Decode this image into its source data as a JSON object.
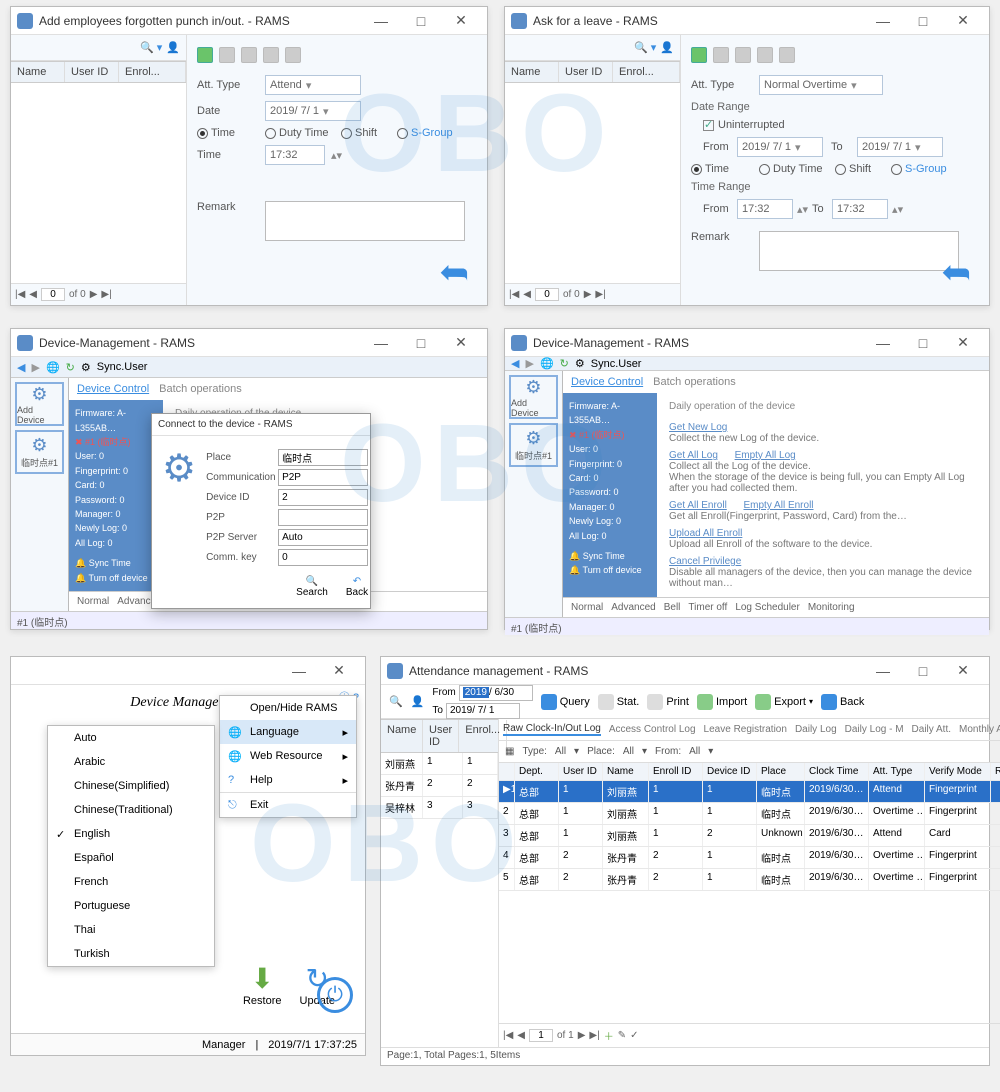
{
  "watermark": "OBO",
  "win_punch": {
    "title": "Add employees forgotten punch in/out. - RAMS",
    "cols": [
      "Name",
      "User ID",
      "Enrol..."
    ],
    "att_type_lbl": "Att. Type",
    "att_type_val": "Attend",
    "date_lbl": "Date",
    "date_val": "2019/ 7/ 1",
    "r_time": "Time",
    "r_duty": "Duty Time",
    "r_shift": "Shift",
    "r_sgroup": "S-Group",
    "time_lbl": "Time",
    "time_val": "17:32",
    "remark_lbl": "Remark",
    "nav_page": "0",
    "nav_total": "of 0"
  },
  "win_leave": {
    "title": "Ask for a leave - RAMS",
    "cols": [
      "Name",
      "User ID",
      "Enrol..."
    ],
    "att_type_lbl": "Att. Type",
    "att_type_val": "Normal Overtime",
    "range_hd": "Date Range",
    "uninterrupted": "Uninterrupted",
    "from_lbl": "From",
    "to_lbl": "To",
    "from_date": "2019/ 7/ 1",
    "to_date": "2019/ 7/ 1",
    "r_time": "Time",
    "r_duty": "Duty Time",
    "r_shift": "Shift",
    "r_sgroup": "S-Group",
    "time_range_hd": "Time Range",
    "t_from": "17:32",
    "t_to": "17:32",
    "remark_lbl": "Remark",
    "nav_page": "0",
    "nav_total": "of 0"
  },
  "dm": {
    "title": "Device-Management - RAMS",
    "syncuser": "Sync.User",
    "side_add": "Add Device",
    "side_dev": "临时点#1",
    "tab_ctrl": "Device Control",
    "tab_batch": "Batch operations",
    "tree": {
      "fw": "Firmware: A-L355AB…",
      "dev": "#1 (临时点)",
      "user": "User: 0",
      "fp": "Fingerprint: 0",
      "card": "Card: 0",
      "pw": "Password: 0",
      "mgr": "Manager: 0",
      "newlog": "Newly Log: 0",
      "alllog": "All Log: 0",
      "sync": "Sync Time",
      "turnoff": "Turn off device"
    },
    "ops": {
      "hd": "Daily operation of the device",
      "getnew": "Get New Log",
      "getnew_d": "Collect the new Log of the device.",
      "getall": "Get All Log",
      "emptyall": "Empty All Log",
      "getall_d1": "Collect all the Log of the device.",
      "getall_d2": "When the storage of the device is being full, you can Empty All Log after you had collected them.",
      "getenroll": "Get All Enroll",
      "emptyenroll": "Empty All Enroll",
      "getenroll_d": "Get all Enroll(Fingerprint, Password, Card) from the…",
      "upload": "Upload All Enroll",
      "upload_d": "Upload all Enroll of the software to the device.",
      "cancel": "Cancel Privilege",
      "cancel_d": "Disable all managers of the device, then you can manage the device without man…"
    },
    "footer_tabs": [
      "Normal",
      "Advanced",
      "Bell",
      "Timer off",
      "Log Scheduler",
      "Monitoring"
    ],
    "status": "#1 (临时点)"
  },
  "connect": {
    "title": "Connect to the device - RAMS",
    "place_l": "Place",
    "place_v": "临时点",
    "comm_l": "Communication",
    "comm_v": "P2P",
    "devid_l": "Device ID",
    "devid_v": "2",
    "p2p_l": "P2P",
    "p2p_v": "",
    "srv_l": "P2P Server",
    "srv_v": "Auto",
    "key_l": "Comm. key",
    "key_v": "0",
    "btn_search": "Search",
    "btn_back": "Back"
  },
  "lang": {
    "heading": "Device Management",
    "menu": [
      "Open/Hide  RAMS",
      "Language",
      "Web Resource",
      "Help",
      "Exit"
    ],
    "langs": [
      "Auto",
      "Arabic",
      "Chinese(Simplified)",
      "Chinese(Traditional)",
      "English",
      "Español",
      "French",
      "Portuguese",
      "Thai",
      "Turkish"
    ],
    "restore": "Restore",
    "update": "Update",
    "status_user": "Manager",
    "status_time": "2019/7/1 17:37:25"
  },
  "att": {
    "title": "Attendance management - RAMS",
    "from_lbl": "From",
    "from_val": "2019/ 6/30",
    "to_lbl": "To",
    "to_val": "2019/ 7/ 1",
    "btn_query": "Query",
    "btn_stat": "Stat.",
    "btn_print": "Print",
    "btn_import": "Import",
    "btn_export": "Export",
    "btn_back": "Back",
    "left_cols": [
      "Name",
      "User ID",
      "Enrol..."
    ],
    "left_rows": [
      {
        "name": "刘丽燕",
        "uid": "1",
        "eid": "1"
      },
      {
        "name": "张丹青",
        "uid": "2",
        "eid": "2"
      },
      {
        "name": "吴梓林",
        "uid": "3",
        "eid": "3"
      }
    ],
    "tabs": [
      "Raw Clock-In/Out Log",
      "Access Control Log",
      "Leave Registration",
      "Daily Log",
      "Daily Log - M",
      "Daily Att.",
      "Monthly Att"
    ],
    "flt_type_l": "Type:",
    "flt_type_v": "All",
    "flt_place_l": "Place:",
    "flt_place_v": "All",
    "flt_from_l": "From:",
    "flt_from_v": "All",
    "grid_cols": [
      "",
      "Dept.",
      "User ID",
      "Name",
      "Enroll ID",
      "Device ID",
      "Place",
      "Clock Time",
      "Att. Type",
      "Verify Mode",
      "Remark"
    ],
    "grid_rows": [
      {
        "n": "1",
        "dept": "总部",
        "uid": "1",
        "name": "刘丽燕",
        "eid": "1",
        "did": "1",
        "place": "临时点",
        "time": "2019/6/30…",
        "type": "Attend",
        "verify": "Fingerprint",
        "rm": ""
      },
      {
        "n": "2",
        "dept": "总部",
        "uid": "1",
        "name": "刘丽燕",
        "eid": "1",
        "did": "1",
        "place": "临时点",
        "time": "2019/6/30…",
        "type": "Overtime …",
        "verify": "Fingerprint",
        "rm": ""
      },
      {
        "n": "3",
        "dept": "总部",
        "uid": "1",
        "name": "刘丽燕",
        "eid": "1",
        "did": "2",
        "place": "Unknown",
        "time": "2019/6/30…",
        "type": "Attend",
        "verify": "Card",
        "rm": ""
      },
      {
        "n": "4",
        "dept": "总部",
        "uid": "2",
        "name": "张丹青",
        "eid": "2",
        "did": "1",
        "place": "临时点",
        "time": "2019/6/30…",
        "type": "Overtime …",
        "verify": "Fingerprint",
        "rm": ""
      },
      {
        "n": "5",
        "dept": "总部",
        "uid": "2",
        "name": "张丹青",
        "eid": "2",
        "did": "1",
        "place": "临时点",
        "time": "2019/6/30…",
        "type": "Overtime …",
        "verify": "Fingerprint",
        "rm": ""
      }
    ],
    "nav_page": "1",
    "nav_of": "of 1",
    "status": "Page:1, Total Pages:1, 5Items"
  }
}
